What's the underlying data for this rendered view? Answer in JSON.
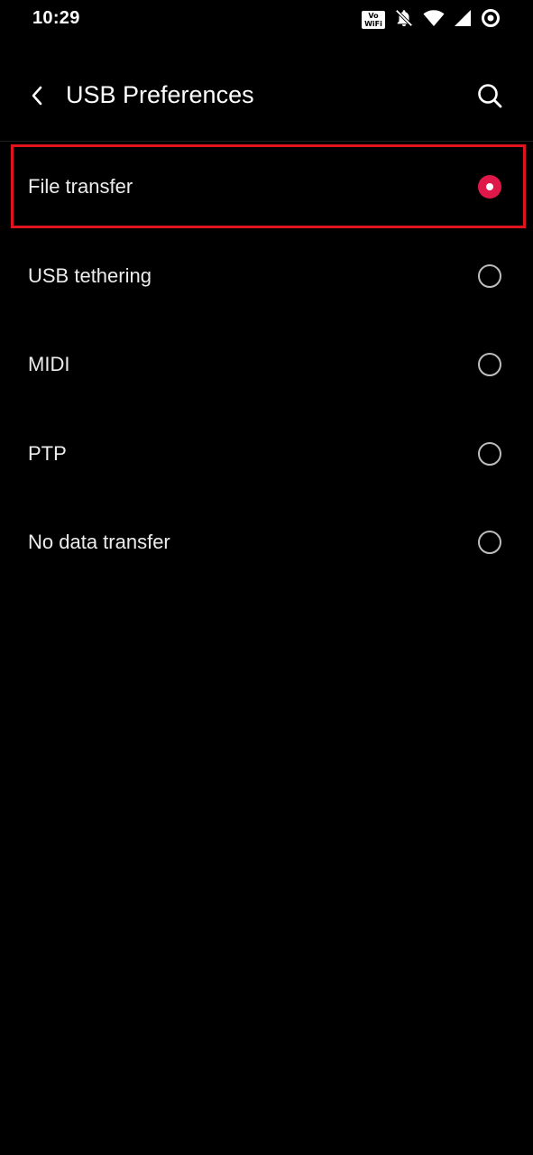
{
  "status_bar": {
    "time": "10:29",
    "vowifi_top": "Vo",
    "vowifi_bottom": "WiFi",
    "icons": [
      "vowifi-icon",
      "notifications-off-icon",
      "wifi-icon",
      "cellular-signal-icon",
      "battery-ring-icon"
    ]
  },
  "header": {
    "title": "USB Preferences",
    "back_icon": "chevron-left-icon",
    "search_icon": "search-icon"
  },
  "options": [
    {
      "label": "File transfer",
      "selected": true
    },
    {
      "label": "USB tethering",
      "selected": false
    },
    {
      "label": "MIDI",
      "selected": false
    },
    {
      "label": "PTP",
      "selected": false
    },
    {
      "label": "No data transfer",
      "selected": false
    }
  ],
  "colors": {
    "background": "#000000",
    "accent": "#e0184a",
    "highlight_box": "#e0141e"
  }
}
